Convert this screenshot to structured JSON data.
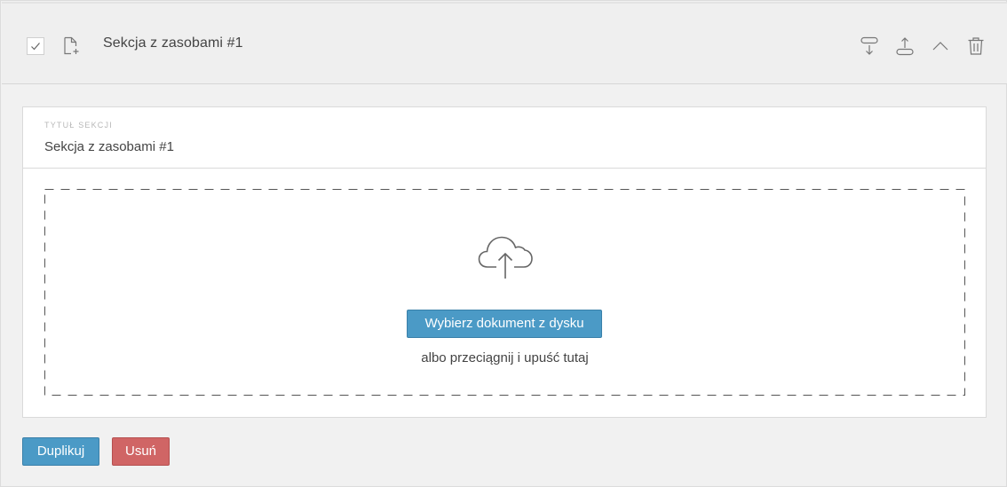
{
  "header": {
    "section_name": "Sekcja z zasobami #1",
    "icons": [
      "checkbox-icon",
      "file-add-icon",
      "move-down-icon",
      "move-up-icon",
      "collapse-icon",
      "trash-icon"
    ]
  },
  "form": {
    "title_label": "TYTUŁ SEKCJI",
    "title_value": "Sekcja z zasobami #1"
  },
  "upload": {
    "button_label": "Wybierz dokument z dysku",
    "hint": "albo przeciągnij i upuść tutaj"
  },
  "actions": {
    "duplicate_label": "Duplikuj",
    "delete_label": "Usuń"
  },
  "colors": {
    "primary": "#4b9ac6",
    "danger": "#d06565"
  }
}
